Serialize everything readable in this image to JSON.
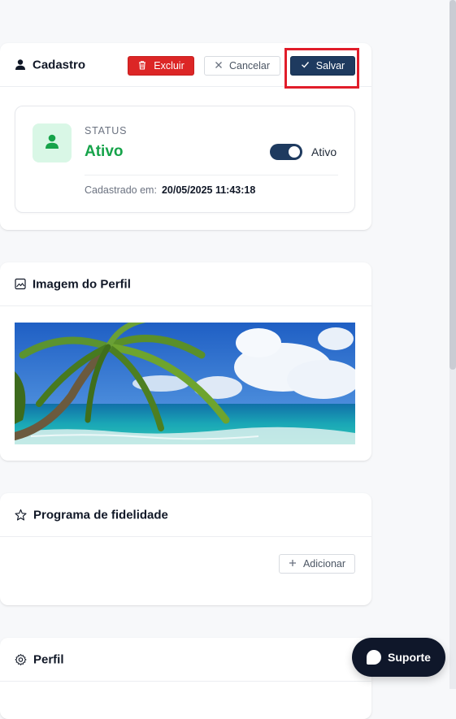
{
  "cadastro": {
    "title": "Cadastro",
    "buttons": {
      "delete": "Excluir",
      "cancel": "Cancelar",
      "save": "Salvar"
    },
    "status": {
      "label": "STATUS",
      "value": "Ativo",
      "toggle_label": "Ativo",
      "toggle_on": true,
      "registered_label": "Cadastrado em:",
      "registered_value": "20/05/2025 11:43:18"
    }
  },
  "imagem": {
    "title": "Imagem do Perfil"
  },
  "programa": {
    "title": "Programa de fidelidade",
    "add_label": "Adicionar"
  },
  "perfil": {
    "title": "Perfil"
  },
  "support": {
    "label": "Suporte"
  },
  "colors": {
    "primary": "#1e3a5f",
    "danger": "#dc2626",
    "success": "#16a34a",
    "highlight": "#e11d2a"
  }
}
